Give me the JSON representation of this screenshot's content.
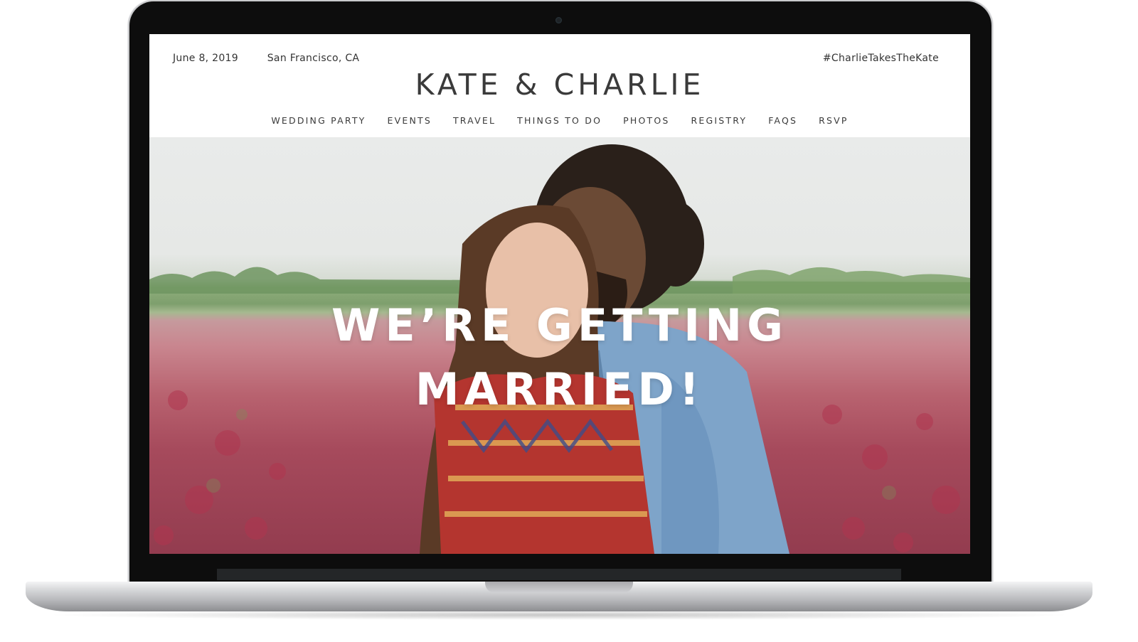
{
  "site": {
    "date": "June 8, 2019",
    "location": "San Francisco, CA",
    "hashtag": "#CharlieTakesTheKate",
    "title": "KATE & CHARLIE"
  },
  "nav": {
    "items": [
      {
        "label": "WEDDING PARTY"
      },
      {
        "label": "EVENTS"
      },
      {
        "label": "TRAVEL"
      },
      {
        "label": "THINGS TO DO"
      },
      {
        "label": "PHOTOS"
      },
      {
        "label": "REGISTRY"
      },
      {
        "label": "FAQS"
      },
      {
        "label": "RSVP"
      }
    ]
  },
  "hero": {
    "line1": "WE’RE GETTING",
    "line2": "MARRIED!"
  },
  "colors": {
    "header_text": "#3a3a3a",
    "headline": "#ffffff",
    "bezel": "#0d0d0d"
  }
}
